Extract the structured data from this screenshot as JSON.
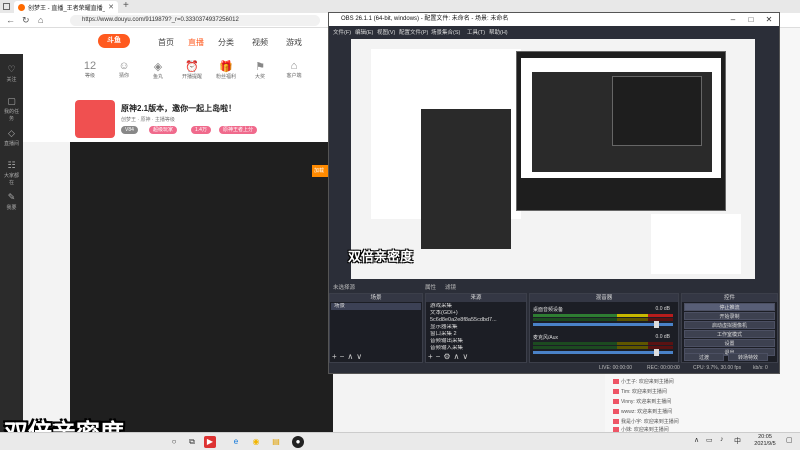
{
  "browser": {
    "tab_title": "创梦王 - 直播_王者荣耀直播_斗...",
    "url": "https://www.douyu.com/9119879?_r=0.3330374937256012"
  },
  "douyu": {
    "logo": "斗鱼",
    "nav": [
      "首页",
      "直播",
      "分类",
      "视频",
      "游戏"
    ],
    "nav_active_index": 1,
    "sidebar": [
      {
        "icon": "♡",
        "label": "关注"
      },
      {
        "icon": "▢",
        "label": "我的任务"
      },
      {
        "icon": "◇",
        "label": "直播间"
      },
      {
        "icon": "☷",
        "label": "大家都在"
      },
      {
        "icon": "✎",
        "label": "我要"
      }
    ],
    "tools": [
      {
        "icon": "12",
        "label": "等级"
      },
      {
        "icon": "☺",
        "label": "猜你"
      },
      {
        "icon": "◈",
        "label": "鱼丸"
      },
      {
        "icon": "⏰",
        "label": "开播提醒"
      },
      {
        "icon": "🎁",
        "label": "粉丝福利"
      },
      {
        "icon": "⚑",
        "label": "大奖"
      },
      {
        "icon": "⌂",
        "label": "客户端"
      }
    ],
    "room_title": "原神2.1版本，邀你一起上岛啦！",
    "room_sub": "创梦王 · 原神 · 主播等级",
    "badges": [
      "V84",
      "超级玩家",
      "1.4万",
      "原神王者上分"
    ],
    "chat": [
      "小王子: 欢迎来到主播间",
      "Tim: 欢迎来到主播间",
      "Vinny: 欢迎来到主播间",
      "wwwz: 欢迎来到主播间",
      "我是小宇: 欢迎来到主播间",
      "小妹: 欢迎来到主播间"
    ],
    "mini_label": "加载"
  },
  "obs": {
    "title": "OBS 26.1.1 (64-bit, windows) - 配置文件: 未命名 - 场景: 未命名",
    "menu": [
      "文件(F)",
      "编辑(E)",
      "视图(V)",
      "配置文件(P)",
      "场景集合(S)",
      "工具(T)",
      "帮助(H)"
    ],
    "sub_left": "未选择源",
    "sub_mid1": "属性",
    "sub_mid2": "滤镜",
    "docks": {
      "scenes_title": "场景",
      "sources_title": "来源",
      "mixer_title": "混音器",
      "controls_title": "控件"
    },
    "scenes": [
      "场景"
    ],
    "sources": [
      "游戏采集",
      "文本(GDI+)",
      "5c6d8e0a2e8f8a55cdbd7...",
      "显示器采集",
      "窗口采集 2",
      "音频输出采集",
      "音频输入采集"
    ],
    "mixer": [
      {
        "name": "桌面音频设备",
        "db": "0.0 dB"
      },
      {
        "name": "麦克风/Aux",
        "db": "0.0 dB"
      }
    ],
    "controls": [
      "停止推流",
      "开始录制",
      "启动虚拟摄像机",
      "工作室模式",
      "设置",
      "退出"
    ],
    "controls_bottom": [
      "过渡",
      "转场特效"
    ],
    "status": {
      "live": "LIVE: 00:00:00",
      "rec": "REC: 00:00:00",
      "cpu": "CPU: 9.7%, 30.00 fps",
      "kb": "kb/s: 0"
    }
  },
  "overlay_text": "双倍亲密度",
  "taskbar": {
    "clock_time": "20:05",
    "clock_date": "2021/9/5"
  }
}
